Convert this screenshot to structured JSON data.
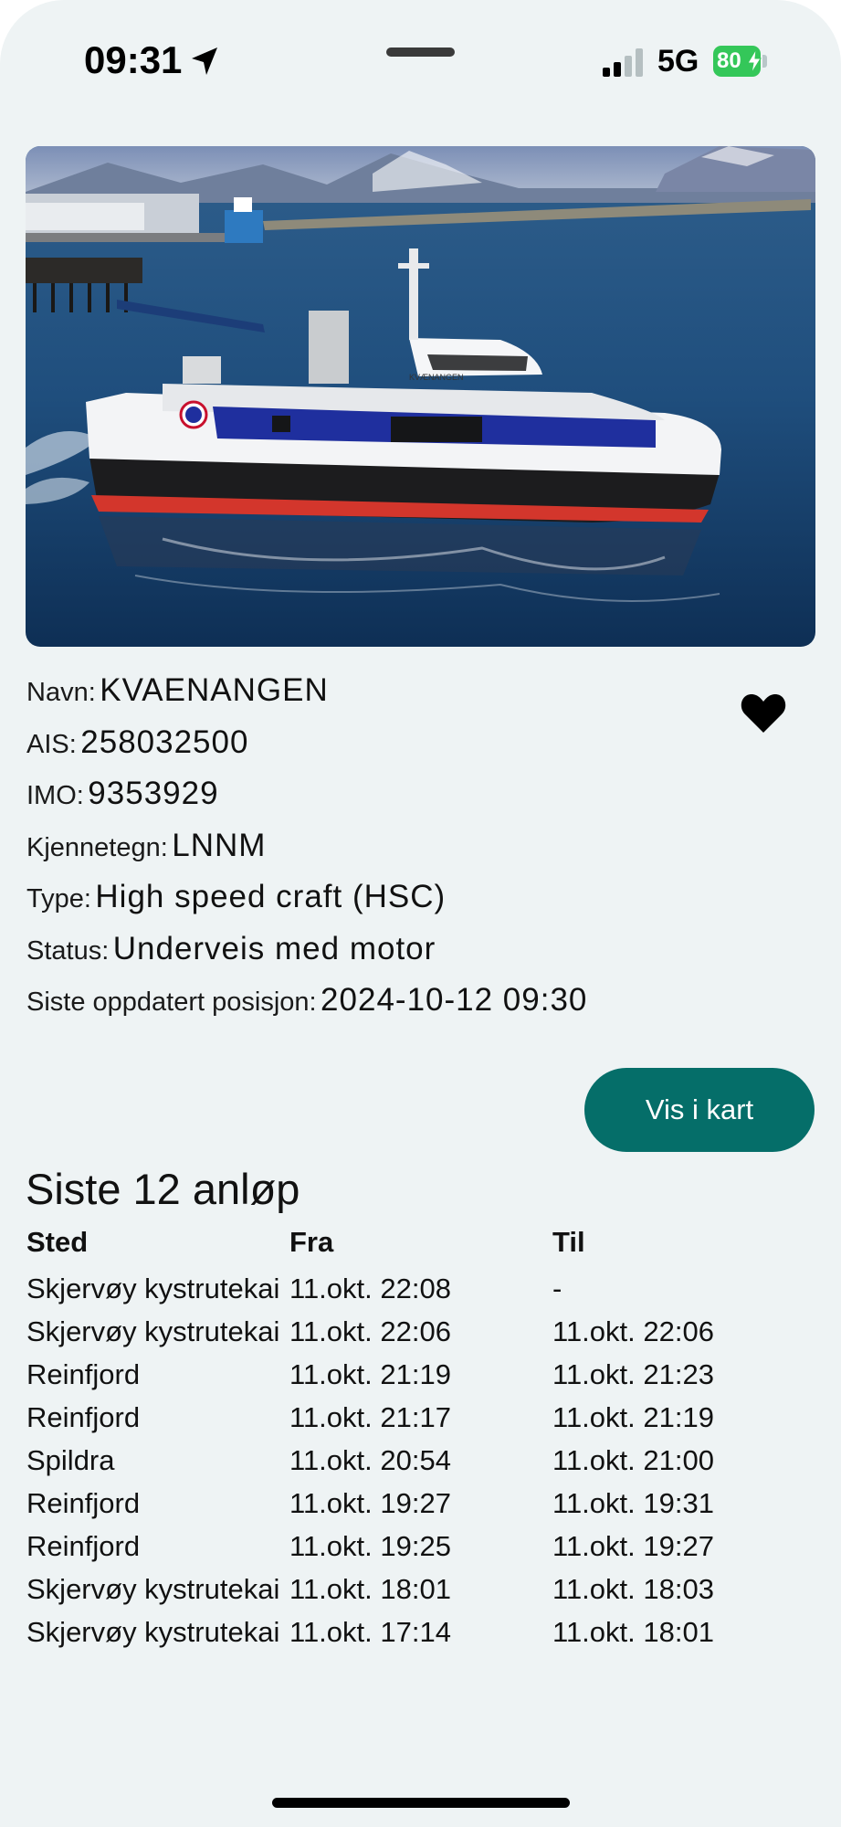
{
  "status_bar": {
    "time": "09:31",
    "network": "5G",
    "battery": "80"
  },
  "vessel": {
    "photo_name": "KVÆNANGEN",
    "fields": [
      {
        "label": "Navn:",
        "value": "KVAENANGEN"
      },
      {
        "label": "AIS:",
        "value": "258032500"
      },
      {
        "label": "IMO:",
        "value": "9353929"
      },
      {
        "label": "Kjennetegn:",
        "value": "LNNM"
      },
      {
        "label": "Type:",
        "value": "High speed craft (HSC)"
      },
      {
        "label": "Status:",
        "value": "Underveis med motor"
      },
      {
        "label": "Siste oppdatert posisjon:",
        "value": "2024-10-12 09:30"
      }
    ],
    "favorite_icon": "heart-filled-icon"
  },
  "map_button": {
    "label": "Vis i kart"
  },
  "port_calls": {
    "title": "Siste 12 anløp",
    "headers": [
      "Sted",
      "Fra",
      "Til"
    ],
    "rows": [
      [
        "Skjervøy kystrutekai",
        "11.okt. 22:08",
        "-"
      ],
      [
        "Skjervøy kystrutekai",
        "11.okt. 22:06",
        "11.okt. 22:06"
      ],
      [
        "Reinfjord",
        "11.okt. 21:19",
        "11.okt. 21:23"
      ],
      [
        "Reinfjord",
        "11.okt. 21:17",
        "11.okt. 21:19"
      ],
      [
        "Spildra",
        "11.okt. 20:54",
        "11.okt. 21:00"
      ],
      [
        "Reinfjord",
        "11.okt. 19:27",
        "11.okt. 19:31"
      ],
      [
        "Reinfjord",
        "11.okt. 19:25",
        "11.okt. 19:27"
      ],
      [
        "Skjervøy kystrutekai",
        "11.okt. 18:01",
        "11.okt. 18:03"
      ],
      [
        "Skjervøy kystrutekai",
        "11.okt. 17:14",
        "11.okt. 18:01"
      ]
    ]
  },
  "colors": {
    "background": "#eef3f4",
    "primary": "#056e69",
    "battery": "#34c759"
  }
}
